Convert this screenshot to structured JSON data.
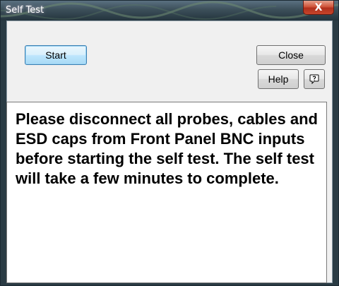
{
  "window": {
    "title": "Self Test",
    "close_glyph": "X"
  },
  "buttons": {
    "start_label": "Start",
    "close_label": "Close",
    "help_label": "Help",
    "context_help_icon": "question-balloon-icon"
  },
  "message": {
    "text": "Please disconnect all probes, cables and ESD caps from Front Panel BNC inputs before starting the self test. The self test will take a few minutes to complete."
  },
  "colors": {
    "title_bar": "#3c4f5a",
    "close_button": "#c8452b",
    "dialog_face": "#f0f0f0",
    "message_background": "#ffffff",
    "default_button_accent": "#3c7fb1"
  }
}
